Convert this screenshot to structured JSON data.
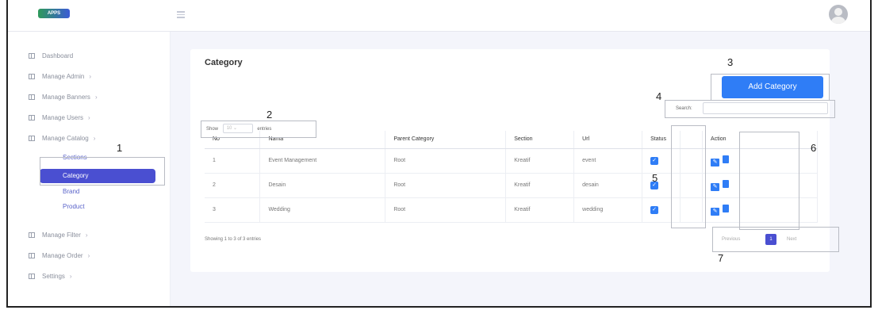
{
  "header": {
    "logo_text": "APPS"
  },
  "sidebar": {
    "items": [
      {
        "label": "Dashboard"
      },
      {
        "label": "Manage Admin"
      },
      {
        "label": "Manage Banners"
      },
      {
        "label": "Manage Users"
      },
      {
        "label": "Manage Catalog"
      },
      {
        "label": "Manage Filter"
      },
      {
        "label": "Manage Order"
      },
      {
        "label": "Settings"
      }
    ],
    "catalog_sub": {
      "sections": "Sections",
      "category": "Category",
      "brand": "Brand",
      "product": "Product"
    }
  },
  "main": {
    "title": "Category",
    "add_button": "Add Category",
    "show_label": "Show",
    "show_value": "10",
    "entries_label": "entries",
    "search_label": "Search:",
    "columns": [
      "No",
      "Nama",
      "Parent Category",
      "Section",
      "Url",
      "Status",
      "",
      "Action"
    ],
    "rows": [
      {
        "no": "1",
        "nama": "Event Management",
        "parent": "Root",
        "section": "Kreatif",
        "url": "event"
      },
      {
        "no": "2",
        "nama": "Desain",
        "parent": "Root",
        "section": "Kreatif",
        "url": "desain"
      },
      {
        "no": "3",
        "nama": "Wedding",
        "parent": "Root",
        "section": "Kreatif",
        "url": "wedding"
      }
    ],
    "showing_text": "Showing 1 to 3 of 3 entries",
    "pager": {
      "previous": "Previous",
      "current": "1",
      "next": "Next"
    }
  },
  "annotations": [
    "1",
    "2",
    "3",
    "4",
    "5",
    "6",
    "7"
  ],
  "colors": {
    "accent": "#2f7df6",
    "active": "#4a4fd1"
  }
}
